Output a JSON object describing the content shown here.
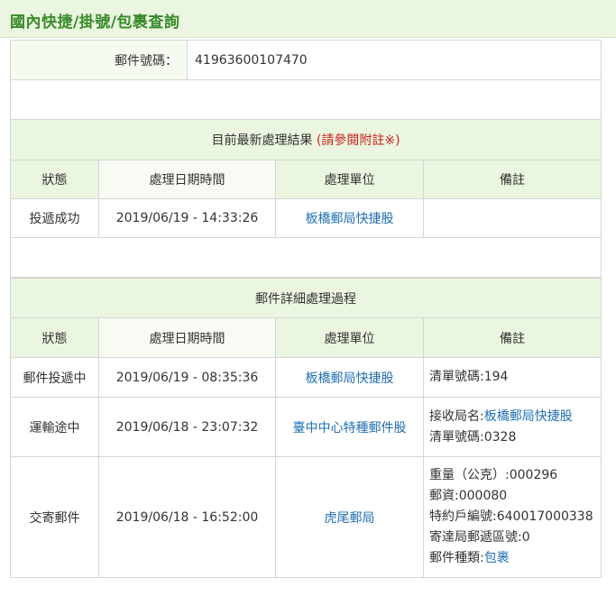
{
  "header": {
    "title": "國內快捷/掛號/包裹查詢"
  },
  "mail": {
    "number_label": "郵件號碼：",
    "number_value": "41963600107470"
  },
  "latest": {
    "heading": "目前最新處理結果",
    "heading_note": "(請參閱附註※)",
    "columns": [
      "狀態",
      "處理日期時間",
      "處理單位",
      "備註"
    ],
    "row": {
      "status": "投遞成功",
      "datetime": "2019/06/19 - 14:33:26",
      "unit": "板橋郵局快捷股",
      "notes": ""
    }
  },
  "detail": {
    "heading": "郵件詳細處理過程",
    "columns": [
      "狀態",
      "處理日期時間",
      "處理單位",
      "備註"
    ],
    "rows": [
      {
        "status": "郵件投遞中",
        "datetime": "2019/06/19 - 08:35:36",
        "unit": "板橋郵局快捷股",
        "note_1_label": "清單號碼:194"
      },
      {
        "status": "運輸途中",
        "datetime": "2019/06/18 - 23:07:32",
        "unit": "臺中中心特種郵件股",
        "note_1_label": "接收局名:",
        "note_1_link": "板橋郵局快捷股",
        "note_2_label": "清單號碼:0328"
      },
      {
        "status": "交寄郵件",
        "datetime": "2019/06/18 - 16:52:00",
        "unit": "虎尾郵局",
        "note_1_label": "重量（公克）:000296",
        "note_2_label": "郵資:000080",
        "note_3_label": "特約戶編號:640017000338",
        "note_4_label": "寄達局郵遞區號:0",
        "note_5_label": "郵件種類:",
        "note_5_link": "包裹"
      }
    ]
  },
  "colors": {
    "header_bg": "#eaf6df",
    "title_green": "#3a8a2a",
    "link_blue": "#1f6fb5",
    "note_red": "#cc1f1f",
    "border": "#d6d6d6"
  }
}
